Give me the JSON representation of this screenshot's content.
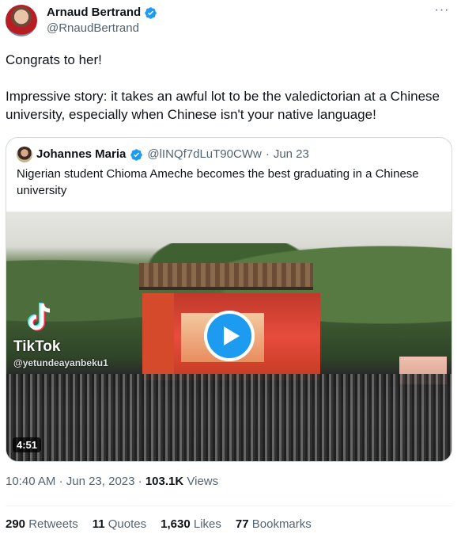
{
  "author": {
    "name": "Arnaud Bertrand",
    "handle": "@RnaudBertrand"
  },
  "tweet": {
    "line1": "Congrats to her!",
    "line2": "Impressive story: it takes an awful lot to be the valedictorian at a Chinese university, especially when Chinese isn't your native language!"
  },
  "quote": {
    "name": "Johannes Maria",
    "handle": "@lINQf7dLuT90CWw",
    "separator": "·",
    "date": "Jun 23",
    "text": "Nigerian student Chioma Ameche becomes the best graduating in a Chinese university"
  },
  "video": {
    "watermark_brand": "TikTok",
    "watermark_user": "@yetundeayanbeku1",
    "duration": "4:51"
  },
  "meta": {
    "time": "10:40 AM",
    "dot1": "·",
    "date": "Jun 23, 2023",
    "dot2": "·",
    "views_count": "103.1K",
    "views_label": "Views"
  },
  "stats": {
    "retweets_count": "290",
    "retweets_label": "Retweets",
    "quotes_count": "11",
    "quotes_label": "Quotes",
    "likes_count": "1,630",
    "likes_label": "Likes",
    "bookmarks_count": "77",
    "bookmarks_label": "Bookmarks"
  },
  "colors": {
    "accent": "#1d9bf0",
    "text": "#0f1419",
    "muted": "#536471"
  }
}
